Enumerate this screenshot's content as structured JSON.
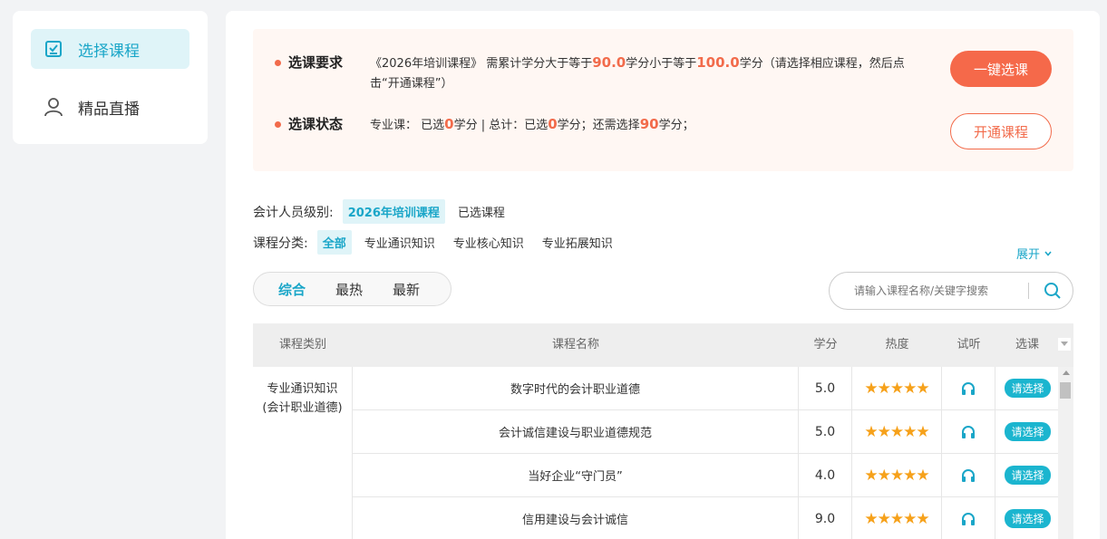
{
  "sidebar": {
    "items": [
      {
        "label": "选择课程",
        "icon": "checklist-icon",
        "active": true
      },
      {
        "label": "精品直播",
        "icon": "user-icon",
        "active": false
      }
    ]
  },
  "requirement": {
    "label": "选课要求",
    "text_before": "《2026年培训课程》 需累计学分大于等于",
    "min_credits": "90.0",
    "text_mid": "学分小于等于",
    "max_credits": "100.0",
    "text_after": "学分（请选择相应课程，然后点击“开通课程”）"
  },
  "status": {
    "label": "选课状态",
    "part1": "专业课：  已选",
    "selected_major": "0",
    "part2": "学分 | 总计：已选",
    "selected_total": "0",
    "part3": "学分；还需选择",
    "needed": "90",
    "part4": "学分；"
  },
  "buttons": {
    "one_click": "一键选课",
    "open_course": "开通课程"
  },
  "filters": {
    "level_label": "会计人员级别:",
    "level_options": [
      {
        "label": "2026年培训课程",
        "active": true
      },
      {
        "label": "已选课程",
        "active": false
      }
    ],
    "category_label": "课程分类:",
    "category_options": [
      {
        "label": "全部",
        "active": true
      },
      {
        "label": "专业通识知识",
        "active": false
      },
      {
        "label": "专业核心知识",
        "active": false
      },
      {
        "label": "专业拓展知识",
        "active": false
      }
    ],
    "expand_label": "展开"
  },
  "sort_tabs": [
    {
      "label": "综合",
      "active": true
    },
    {
      "label": "最热",
      "active": false
    },
    {
      "label": "最新",
      "active": false
    }
  ],
  "search": {
    "placeholder": "请输入课程名称/关键字搜索"
  },
  "table": {
    "headers": [
      "课程类别",
      "课程名称",
      "学分",
      "热度",
      "试听",
      "选课"
    ],
    "category": "专业通识知识(会计职业道德)",
    "rows": [
      {
        "name": "数字时代的会计职业道德",
        "credits": "5.0",
        "rating": 5,
        "stars": "★★★★★",
        "action": "请选择"
      },
      {
        "name": "会计诚信建设与职业道德规范",
        "credits": "5.0",
        "rating": 5,
        "stars": "★★★★★",
        "action": "请选择"
      },
      {
        "name": "当好企业“守门员”",
        "credits": "4.0",
        "rating": 5,
        "stars": "★★★★★",
        "action": "请选择"
      },
      {
        "name": "信用建设与会计诚信",
        "credits": "9.0",
        "rating": 5,
        "stars": "★★★★★",
        "action": "请选择"
      }
    ]
  },
  "colors": {
    "accent": "#1aa6c8",
    "warning": "#f26b4b",
    "star": "#f6a11a"
  }
}
